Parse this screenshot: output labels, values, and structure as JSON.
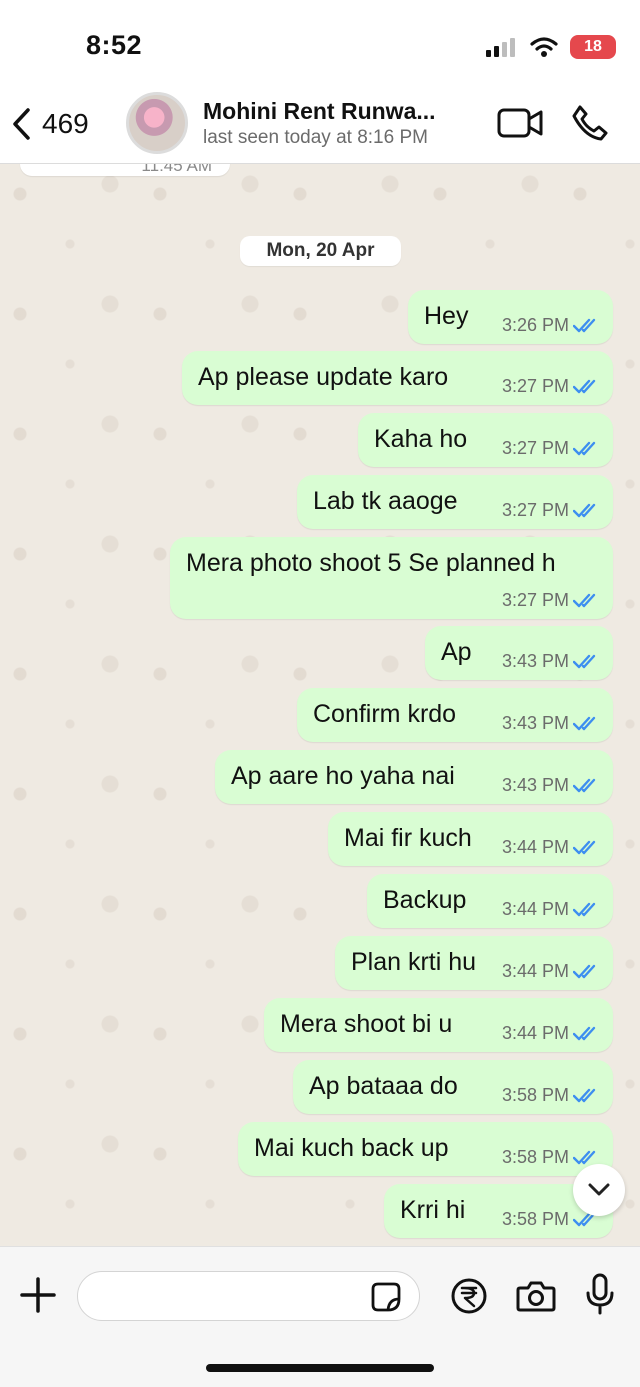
{
  "status_bar": {
    "time": "8:52",
    "battery": "18"
  },
  "header": {
    "back_count": "469",
    "contact_name": "Mohini Rent Runwa...",
    "last_seen": "last seen today at 8:16 PM"
  },
  "chat": {
    "partial_time": "11:45 AM",
    "date_chip": "Mon, 20 Apr",
    "messages": [
      {
        "text": "Hey",
        "time": "3:26 PM"
      },
      {
        "text": "Ap please update karo",
        "time": "3:27 PM"
      },
      {
        "text": "Kaha ho",
        "time": "3:27 PM"
      },
      {
        "text": "Lab tk aaoge",
        "time": "3:27 PM"
      },
      {
        "text": "Mera photo shoot 5 Se planned h",
        "time": "3:27 PM"
      },
      {
        "text": "Ap",
        "time": "3:43 PM"
      },
      {
        "text": "Confirm krdo",
        "time": "3:43 PM"
      },
      {
        "text": "Ap aare ho yaha nai",
        "time": "3:43 PM"
      },
      {
        "text": "Mai fir kuch",
        "time": "3:44 PM"
      },
      {
        "text": "Backup",
        "time": "3:44 PM"
      },
      {
        "text": "Plan krti hu",
        "time": "3:44 PM"
      },
      {
        "text": "Mera shoot bi u",
        "time": "3:44 PM"
      },
      {
        "text": "Ap bataaa do",
        "time": "3:58 PM"
      },
      {
        "text": "Mai kuch back up",
        "time": "3:58 PM"
      },
      {
        "text": "Krri hi",
        "time": "3:58 PM"
      }
    ]
  },
  "composer": {
    "placeholder": ""
  },
  "colors": {
    "outgoing_bubble": "#d9fdd3",
    "read_tick": "#3d8ef0",
    "background": "#efeae2"
  }
}
